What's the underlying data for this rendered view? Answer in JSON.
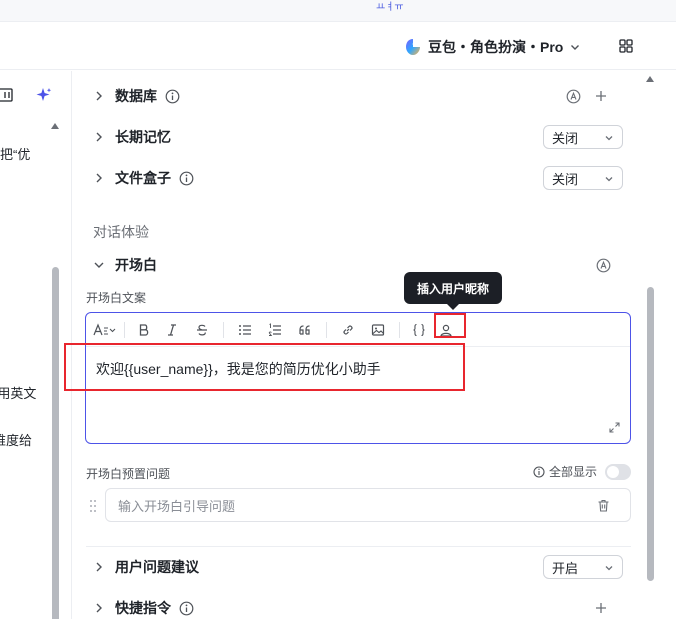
{
  "top_strip": {
    "mark": "ㅛㅕㅠ"
  },
  "header": {
    "model_label": "豆包・角色扮演・Pro",
    "icons": [
      "doubao-logo-icon",
      "chevron-down-icon",
      "grid-icon"
    ]
  },
  "left_column": {
    "fragments": [
      "把“优",
      "“用英文",
      "维度给"
    ],
    "icons": [
      "panel-icon",
      "sparkle-icon"
    ]
  },
  "sections": {
    "database": {
      "label": "数据库"
    },
    "long_memory": {
      "label": "长期记忆",
      "select_value": "关闭"
    },
    "file_box": {
      "label": "文件盒子",
      "select_value": "关闭"
    },
    "dialog_experience": {
      "label": "对话体验"
    },
    "opening": {
      "label": "开场白"
    },
    "user_suggestions": {
      "label": "用户问题建议",
      "select_value": "开启"
    },
    "shortcuts": {
      "label": "快捷指令"
    }
  },
  "opening_editor": {
    "field_label": "开场白文案",
    "text": "欢迎{{user_name}}，我是您的简历优化小助手",
    "tooltip": "插入用户昵称",
    "toolbar_icons": [
      "text-style-icon",
      "bold-icon",
      "italic-icon",
      "strikethrough-icon",
      "bullet-list-icon",
      "numbered-list-icon",
      "quote-icon",
      "link-icon",
      "image-icon",
      "variable-braces-icon",
      "insert-user-nickname-icon"
    ]
  },
  "preset_questions": {
    "field_label": "开场白预置问题",
    "show_all_label": "全部显示",
    "show_all_enabled": false,
    "input_placeholder": "输入开场白引导问题"
  },
  "colors": {
    "accent": "#4d53e8",
    "highlight_box": "#e8262e",
    "tooltip_bg": "#1c1f26"
  }
}
